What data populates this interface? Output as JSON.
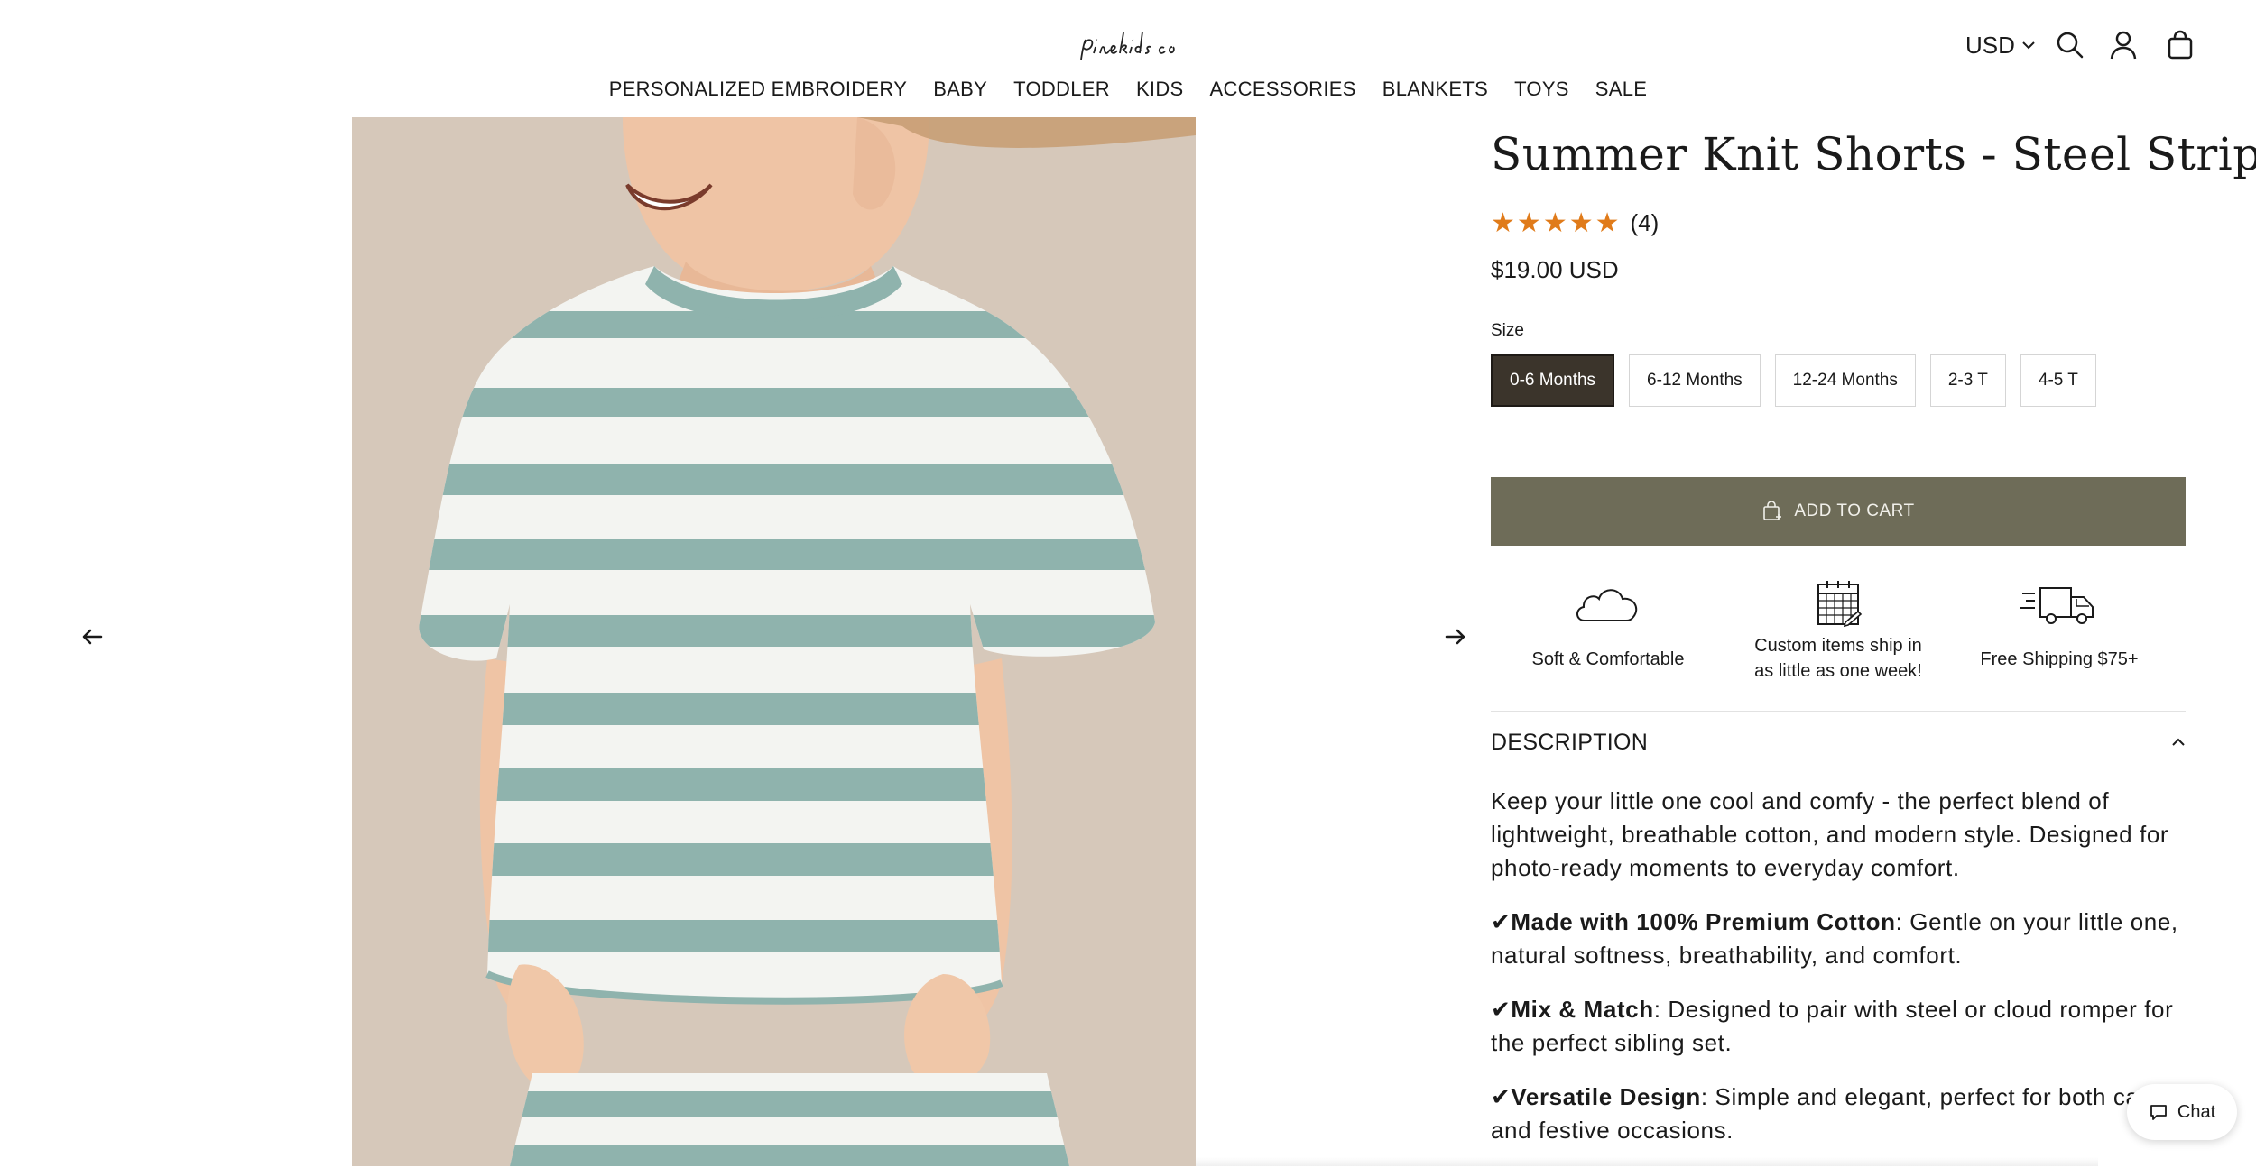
{
  "header": {
    "logo_text": "pine kids co",
    "currency": "USD",
    "nav": [
      "PERSONALIZED EMBROIDERY",
      "BABY",
      "TODDLER",
      "KIDS",
      "ACCESSORIES",
      "BLANKETS",
      "TOYS",
      "SALE"
    ]
  },
  "product": {
    "title": "Summer Knit Shorts - Steel Stripe",
    "rating": 5,
    "rating_count": "(4)",
    "price": "$19.00 USD",
    "size_label": "Size",
    "sizes": [
      "0-6 Months",
      "6-12 Months",
      "12-24 Months",
      "2-3 T",
      "4-5 T"
    ],
    "selected_size": "0-6 Months",
    "add_to_cart_label": "ADD TO CART"
  },
  "features": [
    {
      "icon": "cloud-icon",
      "text": "Soft & Comfortable"
    },
    {
      "icon": "calendar-icon",
      "text_line1": "Custom items ship in",
      "text_line2": "as little as one week!"
    },
    {
      "icon": "delivery-truck-icon",
      "text": "Free Shipping $75+"
    }
  ],
  "description": {
    "title": "DESCRIPTION",
    "intro": "Keep your little one cool and comfy - the perfect blend of lightweight, breathable cotton, and modern style. Designed for photo-ready moments to everyday comfort.",
    "bullets": [
      {
        "check": "✔",
        "bold": "Made with 100% Premium Cotton",
        "text": ": Gentle on your little one, natural softness, breathability, and comfort."
      },
      {
        "check": "✔",
        "bold": "Mix & Match",
        "text": ": Designed to pair with steel or cloud romper for the perfect sibling set."
      },
      {
        "check": "✔",
        "bold": "Versatile Design",
        "text": ": Simple and elegant, perfect for both casual and festive occasions."
      }
    ]
  },
  "chat": {
    "label": "Chat"
  },
  "colors": {
    "add_to_cart_bg": "#6e6c58",
    "selected_size_bg": "#3b342b",
    "star": "#e07b1a",
    "stripe": "#8fb3ad",
    "shirt_white": "#f3f4f1",
    "image_background": "#d6c8ba"
  }
}
